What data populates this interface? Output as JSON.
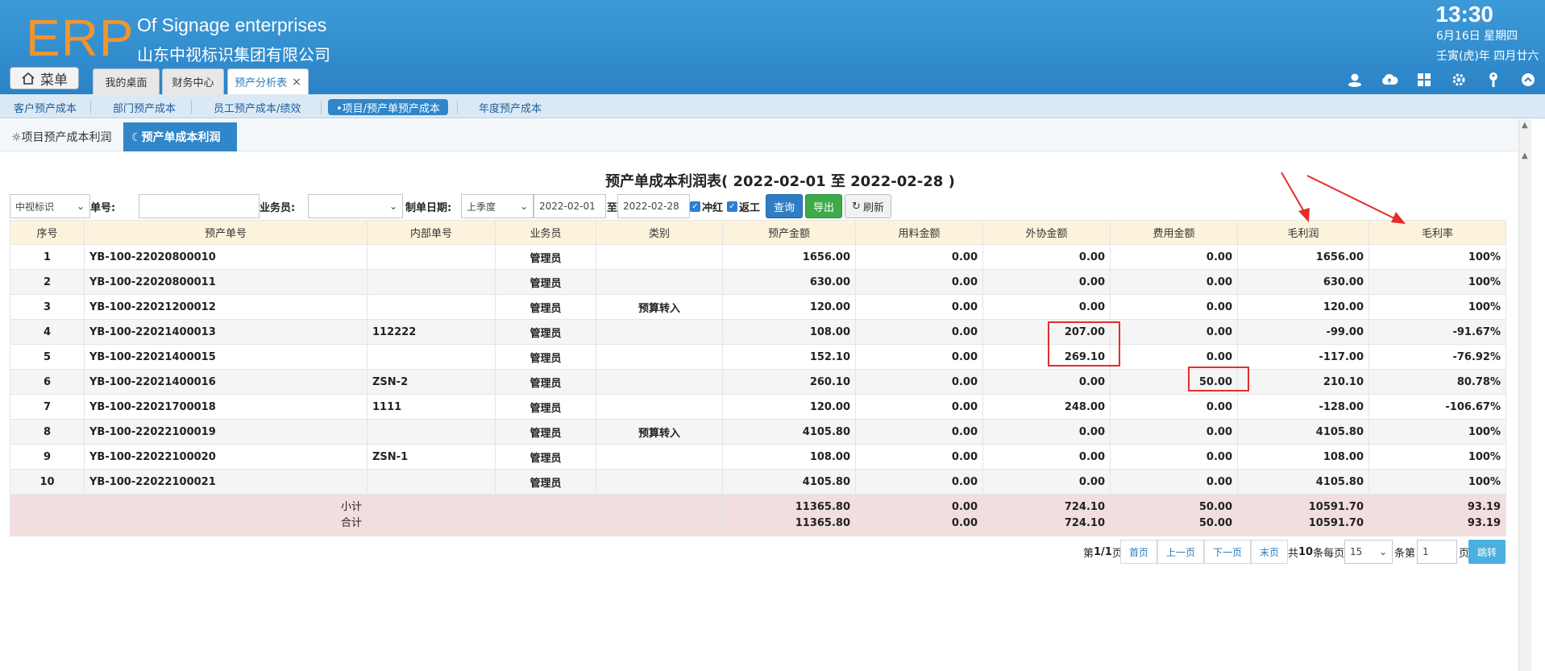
{
  "header": {
    "logo": "ERP",
    "company_en": "Of Signage enterprises",
    "company_cn": "山东中视标识集团有限公司",
    "time": "13:30",
    "date": "6月16日 星期四",
    "lunar": "壬寅(虎)年 四月廿六",
    "menu_label": "菜单",
    "tabs": [
      "我的桌面",
      "财务中心",
      "预产分析表"
    ],
    "tab_close": "×"
  },
  "subnav": {
    "items": [
      "客户预产成本",
      "部门预产成本",
      "员工预产成本/绩效",
      "•项目/预产单预产成本",
      "年度预产成本"
    ]
  },
  "subtabs": {
    "items": [
      "☼项目预产成本利润",
      "☾预产单成本利润"
    ]
  },
  "report": {
    "title": "预产单成本利润表( 2022-02-01 至 2022-02-28 )"
  },
  "toolbar": {
    "company_select": "中视标识",
    "order_label": "单号:",
    "order_value": "",
    "salesman_label": "业务员:",
    "salesman_select": "",
    "date_label": "制单日期:",
    "period_select": "上季度",
    "date_from": "2022-02-01",
    "to_label": "至",
    "date_to": "2022-02-28",
    "check_red": "冲红",
    "check_rework": "返工",
    "query": "查询",
    "export": "导出",
    "refresh": "刷新"
  },
  "table": {
    "headers": [
      "序号",
      "预产单号",
      "内部单号",
      "业务员",
      "类别",
      "预产金额",
      "用料金额",
      "外协金额",
      "费用金额",
      "毛利润",
      "毛利率"
    ],
    "rows": [
      [
        "1",
        "YB-100-22020800010",
        "",
        "管理员",
        "",
        "1656.00",
        "0.00",
        "0.00",
        "0.00",
        "1656.00",
        "100%"
      ],
      [
        "2",
        "YB-100-22020800011",
        "",
        "管理员",
        "",
        "630.00",
        "0.00",
        "0.00",
        "0.00",
        "630.00",
        "100%"
      ],
      [
        "3",
        "YB-100-22021200012",
        "",
        "管理员",
        "预算转入",
        "120.00",
        "0.00",
        "0.00",
        "0.00",
        "120.00",
        "100%"
      ],
      [
        "4",
        "YB-100-22021400013",
        "112222",
        "管理员",
        "",
        "108.00",
        "0.00",
        "207.00",
        "0.00",
        "-99.00",
        "-91.67%"
      ],
      [
        "5",
        "YB-100-22021400015",
        "",
        "管理员",
        "",
        "152.10",
        "0.00",
        "269.10",
        "0.00",
        "-117.00",
        "-76.92%"
      ],
      [
        "6",
        "YB-100-22021400016",
        "ZSN-2",
        "管理员",
        "",
        "260.10",
        "0.00",
        "0.00",
        "50.00",
        "210.10",
        "80.78%"
      ],
      [
        "7",
        "YB-100-22021700018",
        "1111",
        "管理员",
        "",
        "120.00",
        "0.00",
        "248.00",
        "0.00",
        "-128.00",
        "-106.67%"
      ],
      [
        "8",
        "YB-100-22022100019",
        "",
        "管理员",
        "预算转入",
        "4105.80",
        "0.00",
        "0.00",
        "0.00",
        "4105.80",
        "100%"
      ],
      [
        "9",
        "YB-100-22022100020",
        "ZSN-1",
        "管理员",
        "",
        "108.00",
        "0.00",
        "0.00",
        "0.00",
        "108.00",
        "100%"
      ],
      [
        "10",
        "YB-100-22022100021",
        "",
        "管理员",
        "",
        "4105.80",
        "0.00",
        "0.00",
        "0.00",
        "4105.80",
        "100%"
      ]
    ],
    "subtotal_label": "小计",
    "total_label": "合计",
    "subtotal": [
      "11365.80",
      "0.00",
      "724.10",
      "50.00",
      "10591.70",
      "93.19"
    ],
    "total": [
      "11365.80",
      "0.00",
      "724.10",
      "50.00",
      "10591.70",
      "93.19"
    ]
  },
  "pager": {
    "page_info_prefix": "第",
    "page_info_value": "1/1",
    "page_info_suffix": "页",
    "first": "首页",
    "prev": "上一页",
    "next": "下一页",
    "last": "末页",
    "total_prefix": "共",
    "total_value": "10",
    "total_suffix": "条每页",
    "page_size": "15",
    "goto_prefix": "条第",
    "goto_value": "1",
    "goto_suffix": "页",
    "go": "跳转"
  },
  "colors": {
    "header_blue": "#2a83c6",
    "logo_orange": "#f0952f",
    "link_blue": "#2a7cbd",
    "negative_red": "#e41616",
    "highlight_red": "#e52d2d",
    "table_header_bg": "#fcf3dc",
    "summary_bg": "#f2dede"
  }
}
